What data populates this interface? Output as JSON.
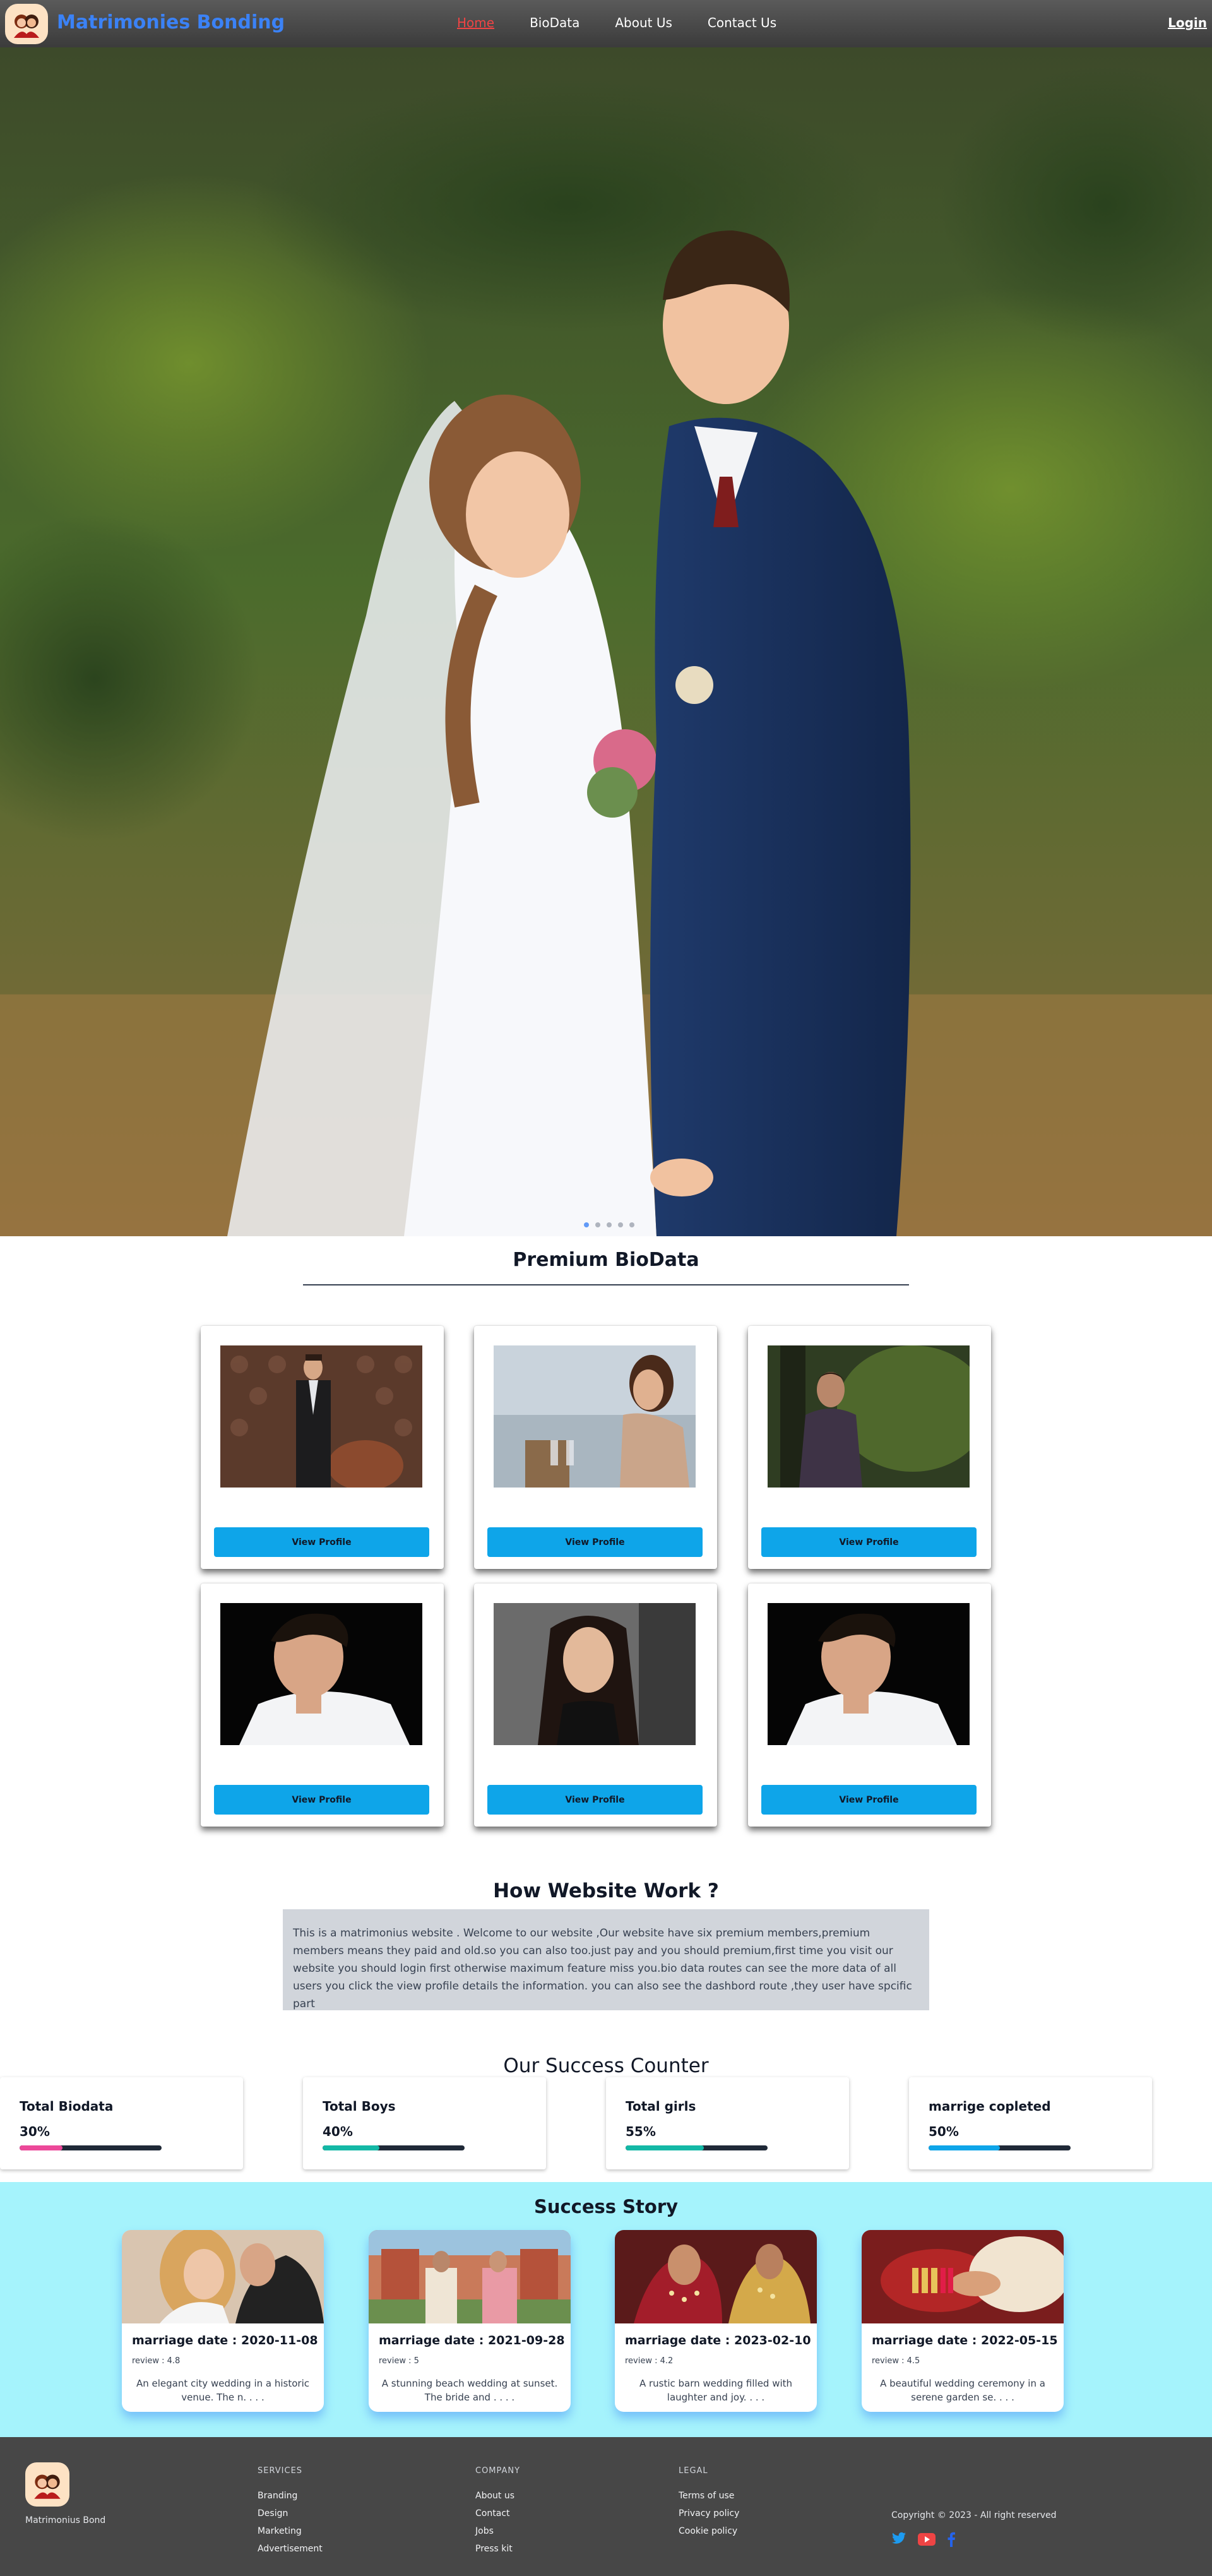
{
  "navbar": {
    "brand": "Matrimonies Bonding",
    "links": [
      "Home",
      "BioData",
      "About Us",
      "Contact Us"
    ],
    "login": "Login"
  },
  "premium": {
    "title": "Premium BioData",
    "button_label": "View Profile"
  },
  "how": {
    "title": "How Website Work ?",
    "text": "This is a matrimonius website . Welcome to our website ,Our website have six premium members,premium members means they paid and old.so you can also too.just pay and you should premium,first time you visit our website you should login first otherwise maximum feature miss you.bio data routes can see the more data of all users you click the view profile details the information. you can also see the dashbord route ,they user have spcific part"
  },
  "counter": {
    "title": "Our Success Counter",
    "stats": [
      {
        "label": "Total Biodata",
        "pct": "30%",
        "value": 0.3,
        "color": "#ec4899"
      },
      {
        "label": "Total Boys",
        "pct": "40%",
        "value": 0.4,
        "color": "#14b8a6"
      },
      {
        "label": "Total girls",
        "pct": "55%",
        "value": 0.55,
        "color": "#14b8a6"
      },
      {
        "label": "marrige copleted",
        "pct": "50%",
        "value": 0.5,
        "color": "#0ea5e9"
      }
    ]
  },
  "success": {
    "title": "Success Story",
    "stories": [
      {
        "date": "marriage date : 2020-11-08",
        "review": "review : 4.8",
        "desc": "An elegant city wedding in a historic venue. The n. . . ."
      },
      {
        "date": "marriage date : 2021-09-28",
        "review": "review : 5",
        "desc": "A stunning beach wedding at sunset. The bride and . . . ."
      },
      {
        "date": "marriage date : 2023-02-10",
        "review": "review : 4.2",
        "desc": "A rustic barn wedding filled with laughter and joy. . . ."
      },
      {
        "date": "marriage date : 2022-05-15",
        "review": "review : 4.5",
        "desc": "A beautiful wedding ceremony in a serene garden se. . . ."
      }
    ]
  },
  "footer": {
    "name": "Matrimonius Bond",
    "services_title": "SERVICES",
    "services": [
      "Branding",
      "Design",
      "Marketing",
      "Advertisement"
    ],
    "company_title": "COMPANY",
    "company": [
      "About us",
      "Contact",
      "Jobs",
      "Press kit"
    ],
    "legal_title": "LEGAL",
    "legal": [
      "Terms of use",
      "Privacy policy",
      "Cookie policy"
    ],
    "copyright": "Copyright © 2023 - All right reserved"
  }
}
